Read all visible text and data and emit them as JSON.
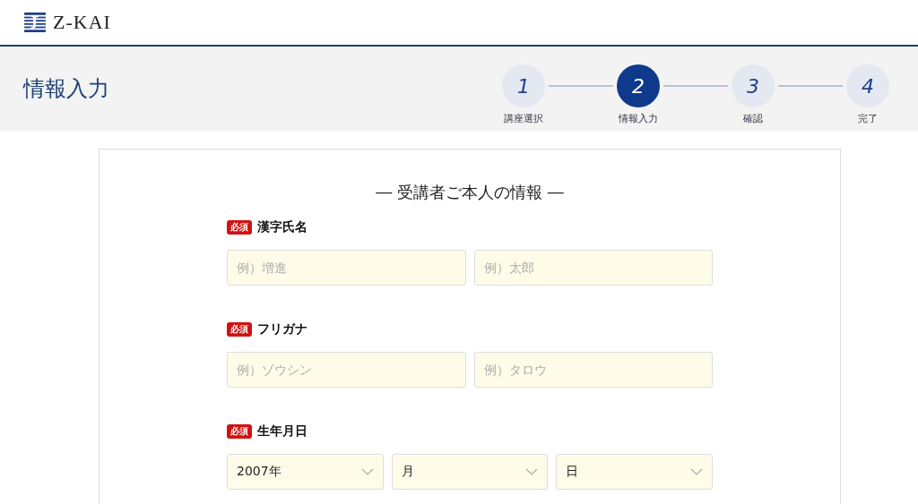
{
  "header": {
    "logo_text": "Z-KAI"
  },
  "page_title": "情報入力",
  "steps": [
    {
      "number": "1",
      "label": "講座選択",
      "selected": false
    },
    {
      "number": "2",
      "label": "情報入力",
      "selected": true
    },
    {
      "number": "3",
      "label": "確認",
      "selected": false
    },
    {
      "number": "4",
      "label": "完了",
      "selected": false
    }
  ],
  "form": {
    "heading": "― 受講者ご本人の情報 ―",
    "fields": [
      {
        "kind": "text",
        "badge": "必須",
        "label": "漢字氏名",
        "inputs": [
          {
            "placeholder": "例）増進"
          },
          {
            "placeholder": "例）太郎"
          }
        ]
      },
      {
        "kind": "text",
        "badge": "必須",
        "label": "フリガナ",
        "inputs": [
          {
            "placeholder": "例）ゾウシン"
          },
          {
            "placeholder": "例）タロウ"
          }
        ]
      },
      {
        "kind": "select",
        "badge": "必須",
        "label": "生年月日",
        "inputs": [
          {
            "value": "2007年"
          },
          {
            "value": "月"
          },
          {
            "value": "日"
          }
        ]
      }
    ]
  }
}
